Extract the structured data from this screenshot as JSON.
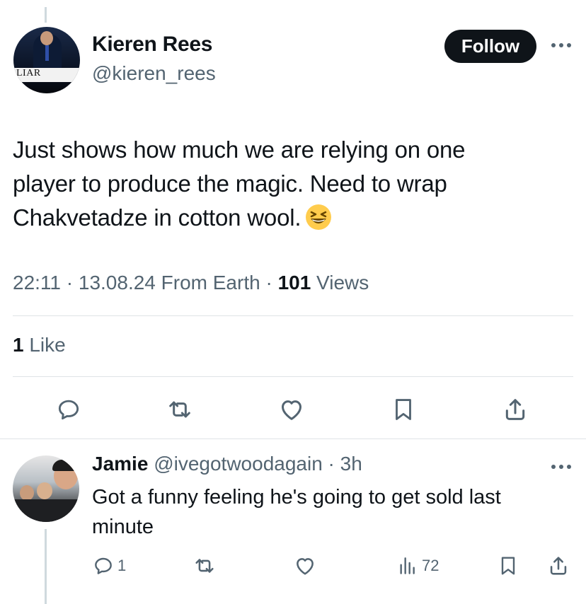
{
  "tweet": {
    "author_name": "Kieren Rees",
    "author_handle": "@kieren_rees",
    "avatar_caption": "LIAR",
    "follow_label": "Follow",
    "text_lines": [
      "Just shows how much we are relying on one",
      "player to produce the magic. Need to wrap",
      "Chakvetadze in cotton wool."
    ],
    "emoji": "grinning-squinting-face",
    "meta_prefix": "22:11 · 13.08.24 From Earth · ",
    "views_count": "101",
    "views_label": " Views",
    "likes_count": "1",
    "likes_label": " Like"
  },
  "actions": {
    "icons": [
      "reply-icon",
      "retweet-icon",
      "like-icon",
      "bookmark-icon",
      "share-icon"
    ]
  },
  "reply": {
    "author_name": "Jamie",
    "author_handle": "@ivegotwoodagain · 3h",
    "text": "Got a funny feeling he's going to get sold last minute",
    "reply_count": "1",
    "views_count": "72"
  },
  "colors": {
    "text": "#0f1419",
    "muted": "#536471",
    "divider": "#dfe3e6",
    "thread_line": "#cfd9de",
    "button_bg": "#0f1419",
    "emoji_yellow": "#ffcc4d"
  }
}
